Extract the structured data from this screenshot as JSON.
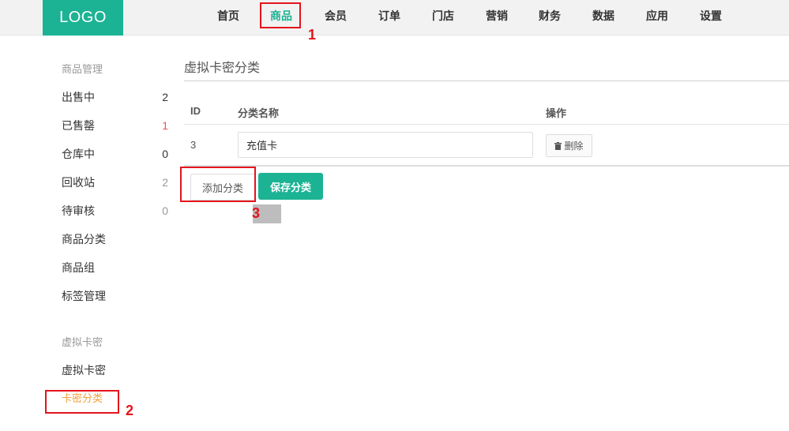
{
  "header": {
    "logo": "LOGO",
    "nav": [
      {
        "label": "首页"
      },
      {
        "label": "商品"
      },
      {
        "label": "会员"
      },
      {
        "label": "订单"
      },
      {
        "label": "门店"
      },
      {
        "label": "营销"
      },
      {
        "label": "财务"
      },
      {
        "label": "数据"
      },
      {
        "label": "应用"
      },
      {
        "label": "设置"
      }
    ],
    "active_nav": "商品"
  },
  "sidebar": {
    "groups": [
      {
        "title": "商品管理",
        "items": [
          {
            "label": "出售中",
            "count": "2"
          },
          {
            "label": "已售罄",
            "count": "1"
          },
          {
            "label": "仓库中",
            "count": "0"
          },
          {
            "label": "回收站",
            "count": "2"
          },
          {
            "label": "待审核",
            "count": "0"
          },
          {
            "label": "商品分类"
          },
          {
            "label": "商品组"
          },
          {
            "label": "标签管理"
          }
        ]
      },
      {
        "title": "虚拟卡密",
        "items": [
          {
            "label": "虚拟卡密"
          },
          {
            "label": "卡密分类"
          }
        ]
      }
    ],
    "active_item": "卡密分类"
  },
  "main": {
    "title": "虚拟卡密分类",
    "table": {
      "headers": [
        "ID",
        "分类名称",
        "操作"
      ],
      "rows": [
        {
          "id": "3",
          "name": "充值卡",
          "delete_label": "删除"
        }
      ]
    },
    "add_label": "添加分类",
    "save_label": "保存分类"
  },
  "annotations": [
    "1",
    "2",
    "3"
  ],
  "colors": {
    "brand": "#1bb394",
    "active_sidebar": "#f0a23c",
    "annotation": "#e3141c",
    "count_red": "#ee5555"
  },
  "icons": {
    "delete": "trash-icon"
  }
}
